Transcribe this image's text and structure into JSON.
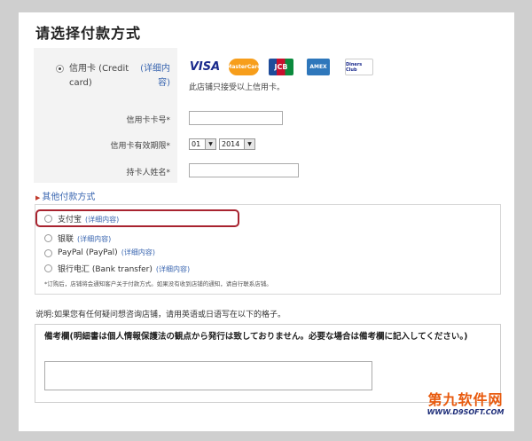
{
  "title": "请选择付款方式",
  "credit_card": {
    "label": "信用卡 (Credit card)",
    "detail": "(详细内容)",
    "cards_note": "此店铺只接受以上信用卡。",
    "logos": [
      {
        "text": "VISA",
        "name": "visa-logo"
      },
      {
        "text": "MasterCard",
        "name": "mastercard-logo"
      },
      {
        "text": "JCB",
        "name": "jcb-logo"
      },
      {
        "text": "AMEX",
        "name": "amex-logo"
      },
      {
        "text": "Diners Club",
        "name": "diners-logo"
      }
    ]
  },
  "form": {
    "card_number_label": "信用卡卡号*",
    "expiry_label": "信用卡有效期限*",
    "expiry_month": "01",
    "expiry_year": "2014",
    "holder_label": "持卡人姓名*"
  },
  "other_methods": {
    "toggle_label": "其他付款方式",
    "options": [
      {
        "label": "支付宝",
        "detail": "(详细内容)"
      },
      {
        "label": "银联",
        "detail": "(详细内容)"
      },
      {
        "label": "PayPal (PayPal)",
        "detail": "(详细内容)"
      },
      {
        "label": "银行电汇 (Bank transfer)",
        "detail": "(详细内容)"
      }
    ],
    "note": "*订购后，店铺将会通知客户关于付款方式。如果没有收到店铺的通知，请自行联系店铺。"
  },
  "explain": "说明:如果您有任何疑问想咨询店铺，请用英语或日语写在以下的格子。",
  "remark": {
    "text": "備考欄(明細書は個人情報保護法の観点から発行は致しておりません。必要な場合は備考欄に記入してください。)"
  },
  "watermark": {
    "cn": "第九软件网",
    "en": "WWW.D9SOFT.COM"
  },
  "colors": {
    "link": "#3a66b0",
    "highlight_border": "#a8232f",
    "watermark_orange": "#e85a0e"
  }
}
